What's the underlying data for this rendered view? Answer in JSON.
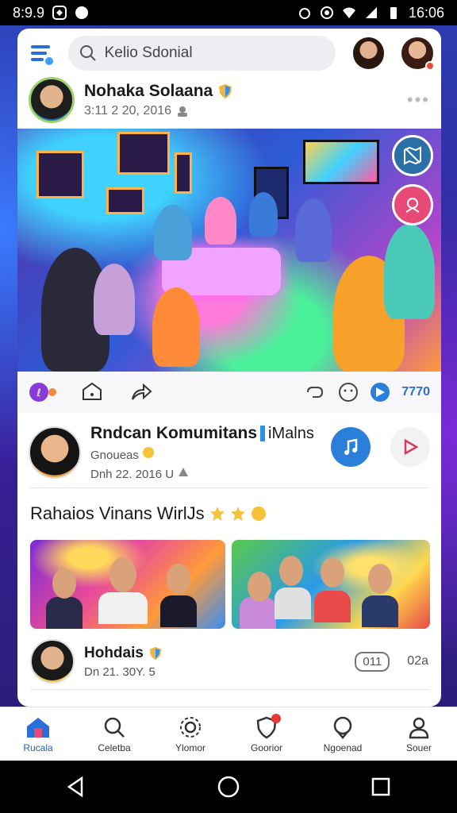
{
  "status_bar": {
    "time_left": "8:9.9",
    "time_right": "16:06"
  },
  "search": {
    "placeholder": "Kelio Sdonial"
  },
  "post": {
    "author": "Nohaka Solaana",
    "meta": "3:11 2 20, 2016"
  },
  "actions": {
    "count": "7770"
  },
  "community": {
    "title": "Rndcan Komumitans",
    "tag": "iMalns",
    "subline": "Gnoueas",
    "date": "Dnh 22. 2016 U"
  },
  "gallery": {
    "title": "Rahaios Vinans WirlJs"
  },
  "comment": {
    "name": "Hohdais",
    "meta": "Dn 21. 30Y. 5",
    "pill": "011",
    "count": "02a"
  },
  "bottom_nav": [
    {
      "label": "Rucala",
      "icon": "home-icon",
      "active": true
    },
    {
      "label": "Celetba",
      "icon": "search-icon"
    },
    {
      "label": "Ylomor",
      "icon": "explore-icon"
    },
    {
      "label": "Goorior",
      "icon": "heart-shield-icon"
    },
    {
      "label": "Ngoenad",
      "icon": "chat-icon"
    },
    {
      "label": "Souer",
      "icon": "profile-icon"
    }
  ],
  "colors": {
    "accent": "#2a7fd8",
    "brand": "#1f5fc0",
    "badge": "#e53935"
  }
}
